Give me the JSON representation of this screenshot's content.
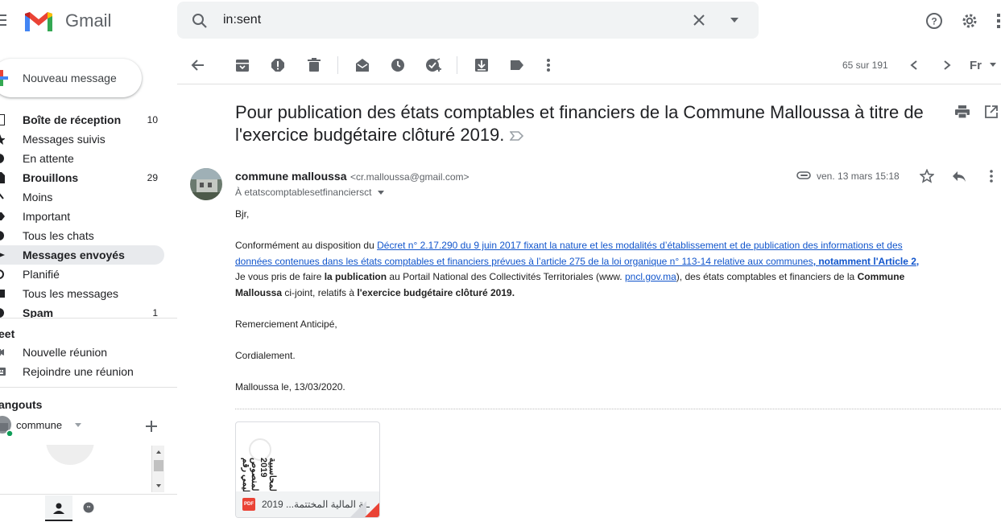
{
  "app": {
    "name": "Gmail"
  },
  "search": {
    "query": "in:sent"
  },
  "compose": {
    "label": "Nouveau message"
  },
  "sidebar": {
    "items": [
      {
        "label": "Boîte de réception",
        "count": "10",
        "bold": true
      },
      {
        "label": "Messages suivis",
        "count": ""
      },
      {
        "label": "En attente",
        "count": ""
      },
      {
        "label": "Brouillons",
        "count": "29",
        "bold": true
      },
      {
        "label": "Moins",
        "count": ""
      },
      {
        "label": "Important",
        "count": ""
      },
      {
        "label": "Tous les chats",
        "count": ""
      },
      {
        "label": "Messages envoyés",
        "count": "",
        "bold": true,
        "active": true
      },
      {
        "label": "Planifié",
        "count": ""
      },
      {
        "label": "Tous les messages",
        "count": ""
      },
      {
        "label": "Spam",
        "count": "1",
        "bold": true
      }
    ]
  },
  "meet": {
    "title": "eet",
    "new_meeting": "Nouvelle réunion",
    "join_meeting": "Rejoindre une réunion"
  },
  "hangouts": {
    "title": "angouts",
    "user": "commune"
  },
  "toolbar": {
    "pager": "65 sur 191",
    "input_tool": "Fr"
  },
  "message": {
    "subject_line1": "Pour publication des états comptables et financiers de la Commune Malloussa à titre de",
    "subject_line2": "l'exercice budgétaire clôturé 2019.",
    "sender_name": "commune malloussa",
    "sender_email": "<cr.malloussa@gmail.com>",
    "to": "À etatscomptablesetfinanciersct",
    "date": "ven. 13 mars 15:18",
    "greeting": "Bjr,",
    "p1_intro": "Conformément au disposition du ",
    "p1_link_a": "Décret n° 2.17.290  du 9 juin 2017 fixant la nature et les modalités d’établissement et de publication des informations et des",
    "p1_link_b": "données contenues dans les états comptables et financiers prévues à l’article 275 de la loi organique n° 113-14 relative aux communes",
    "p1_link_bold": ", notamment l'Article 2, ",
    "p2_a": "Je vous pris de faire ",
    "p2_bold": "la publication",
    "p2_b": " au Portail National des Collectivités Territoriales (www. ",
    "p2_link": "pncl.gov.ma",
    "p2_c": "), des états comptables et financiers de la ",
    "p2_bold2": "Commune",
    "p3_bold": "Malloussa",
    "p3_a": " ci-joint, relatifs à ",
    "p3_bold2": "l'exercice budgétaire clôturé 2019.",
    "thanks": "Remerciement Anticipé,",
    "closing": "Cordialement.",
    "signature": "Malloussa le, 13/03/2020."
  },
  "attachment": {
    "name": "2019 ...ـنة المالية المختتمة",
    "type_badge": "PDF",
    "preview_line1": "القوائم المحاسبية",
    "preview_line2": "2019",
    "preview_line3": "المنصوص",
    "preview_line4": "التنظيمي رقم"
  },
  "colors": {
    "accent_red": "#ea4335",
    "link": "#1155cc",
    "active_nav": "#e8eaed",
    "online_green": "#0f9d58"
  }
}
